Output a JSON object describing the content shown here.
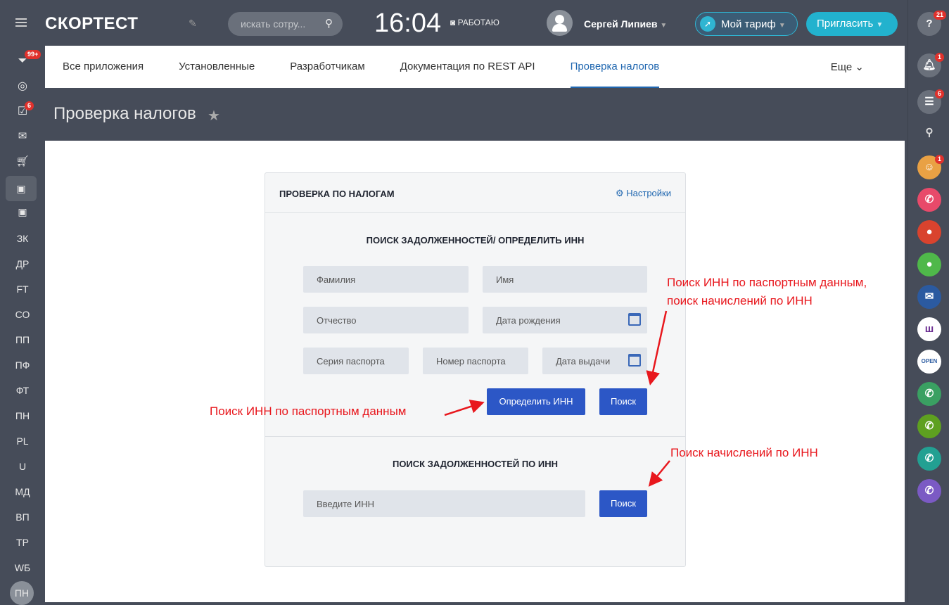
{
  "header": {
    "logo": "СКОРТЕСТ",
    "search_placeholder": "искать сотру...",
    "time": "16:04",
    "status": "РАБОТАЮ",
    "user": "Сергей Липиев",
    "tariff": "Мой тариф",
    "invite": "Пригласить",
    "help_badge": "21"
  },
  "left_sidebar": {
    "badges": {
      "filter": "99+",
      "tasks": "6"
    },
    "items": [
      "ЗК",
      "ДР",
      "FT",
      "СО",
      "ПП",
      "ПФ",
      "ФТ",
      "ПН",
      "PL",
      "U",
      "МД",
      "ВП",
      "ТР",
      "WБ",
      "ПН"
    ]
  },
  "right_sidebar": {
    "notifications_badge": "1",
    "chat_badge": "6",
    "avatar_badge": "1"
  },
  "tabs": {
    "items": [
      "Все приложения",
      "Установленные",
      "Разработчикам",
      "Документация по REST API",
      "Проверка налогов"
    ],
    "active": 4,
    "more": "Еще"
  },
  "page": {
    "title": "Проверка налогов"
  },
  "card": {
    "title": "ПРОВЕРКА ПО НАЛОГАМ",
    "settings": "Настройки",
    "section1": {
      "title": "ПОИСК ЗАДОЛЖЕННОСТЕЙ/ ОПРЕДЕЛИТЬ ИНН",
      "last_name": "Фамилия",
      "first_name": "Имя",
      "middle_name": "Отчество",
      "birth_date": "Дата рождения",
      "passport_series": "Серия паспорта",
      "passport_number": "Номер паспорта",
      "issue_date": "Дата выдачи",
      "find_inn": "Определить ИНН",
      "search": "Поиск"
    },
    "section2": {
      "title": "ПОИСК ЗАДОЛЖЕННОСТЕЙ ПО ИНН",
      "inn_placeholder": "Введите ИНН",
      "search": "Поиск"
    }
  },
  "annotations": {
    "a1_line1": "Поиск ИНН по паспортным данным,",
    "a1_line2": "поиск начислений по ИНН",
    "a2": "Поиск ИНН по паспортным данным",
    "a3": "Поиск начислений по ИНН"
  },
  "colors": {
    "accent": "#2c57c6",
    "annotation": "#e8171d",
    "invite": "#22b2ce"
  }
}
